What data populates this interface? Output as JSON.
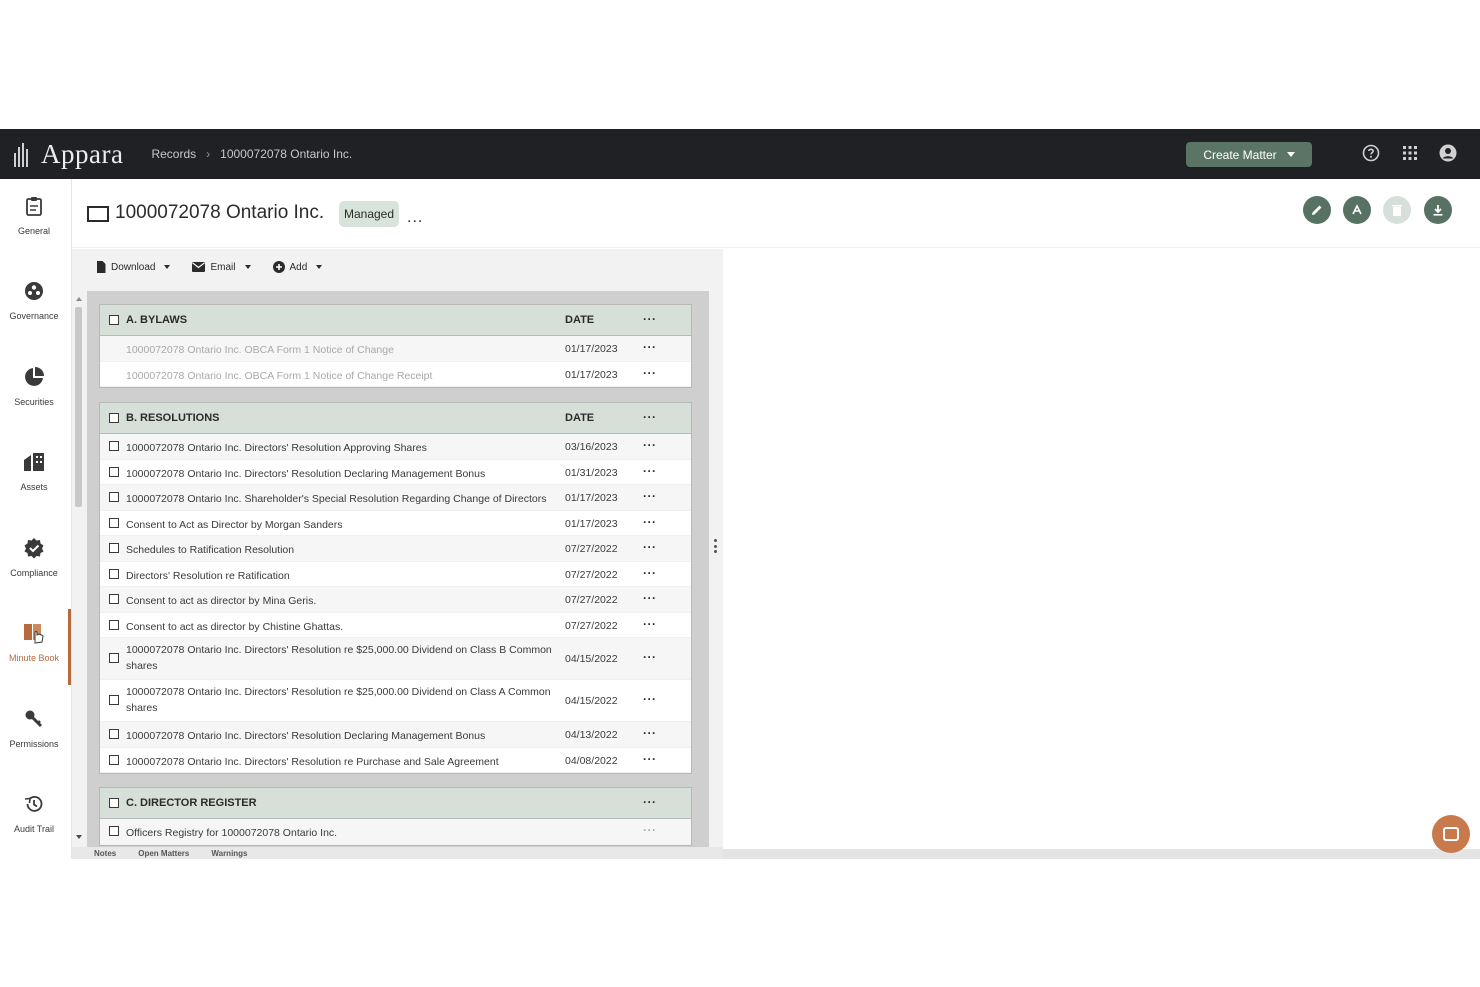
{
  "app": {
    "name": "Appara"
  },
  "breadcrumb": {
    "root": "Records",
    "current": "1000072078 Ontario Inc."
  },
  "header_actions": {
    "create_matter": "Create Matter"
  },
  "rail": [
    {
      "label": "General",
      "icon": "clipboard-icon"
    },
    {
      "label": "Governance",
      "icon": "governance-icon"
    },
    {
      "label": "Securities",
      "icon": "pie-chart-icon"
    },
    {
      "label": "Assets",
      "icon": "buildings-icon"
    },
    {
      "label": "Compliance",
      "icon": "check-badge-icon"
    },
    {
      "label": "Minute Book",
      "icon": "book-icon",
      "active": true
    },
    {
      "label": "Permissions",
      "icon": "key-icon"
    },
    {
      "label": "Audit Trail",
      "icon": "history-icon"
    }
  ],
  "entity": {
    "title": "1000072078 Ontario Inc.",
    "badge": "Managed",
    "more": "..."
  },
  "toolbar": {
    "download": "Download",
    "email": "Email",
    "add": "Add"
  },
  "sections": [
    {
      "title": "A. BYLAWS",
      "date_header": "DATE",
      "rows": [
        {
          "name": "1000072078 Ontario Inc. OBCA Form 1 Notice of Change",
          "date": "01/17/2023",
          "muted": true
        },
        {
          "name": "1000072078 Ontario Inc. OBCA Form 1 Notice of Change Receipt",
          "date": "01/17/2023",
          "muted": true
        }
      ]
    },
    {
      "title": "B. RESOLUTIONS",
      "date_header": "DATE",
      "rows": [
        {
          "name": "1000072078 Ontario Inc. Directors' Resolution Approving Shares",
          "date": "03/16/2023"
        },
        {
          "name": "1000072078 Ontario Inc. Directors' Resolution Declaring Management Bonus",
          "date": "01/31/2023"
        },
        {
          "name": "1000072078 Ontario Inc. Shareholder's Special Resolution Regarding Change of Directors",
          "date": "01/17/2023"
        },
        {
          "name": "Consent to Act as Director by Morgan Sanders",
          "date": "01/17/2023"
        },
        {
          "name": "Schedules to Ratification Resolution",
          "date": "07/27/2022"
        },
        {
          "name": "Directors' Resolution re Ratification",
          "date": "07/27/2022"
        },
        {
          "name": "Consent to act as director by Mina Geris.",
          "date": "07/27/2022"
        },
        {
          "name": "Consent to act as director by Chistine Ghattas.",
          "date": "07/27/2022"
        },
        {
          "name": "1000072078 Ontario Inc. Directors' Resolution re $25,000.00 Dividend on Class B Common shares",
          "date": "04/15/2022",
          "tall": true
        },
        {
          "name": "1000072078 Ontario Inc. Directors' Resolution re $25,000.00 Dividend on Class A Common shares",
          "date": "04/15/2022",
          "tall": true
        },
        {
          "name": "1000072078 Ontario Inc. Directors' Resolution Declaring Management Bonus",
          "date": "04/13/2022"
        },
        {
          "name": "1000072078 Ontario Inc. Directors' Resolution re Purchase and Sale Agreement",
          "date": "04/08/2022"
        }
      ]
    },
    {
      "title": "C. DIRECTOR REGISTER",
      "date_header": "",
      "rows": [
        {
          "name": "Officers Registry for 1000072078 Ontario Inc.",
          "date": ""
        }
      ]
    }
  ],
  "bottom_tabs": [
    "Notes",
    "Open Matters",
    "Warnings"
  ],
  "colors": {
    "topbar": "#1f2125",
    "accent_green": "#5a7565",
    "section_header": "#d6e0d9",
    "active_orange": "#b86a3c"
  }
}
